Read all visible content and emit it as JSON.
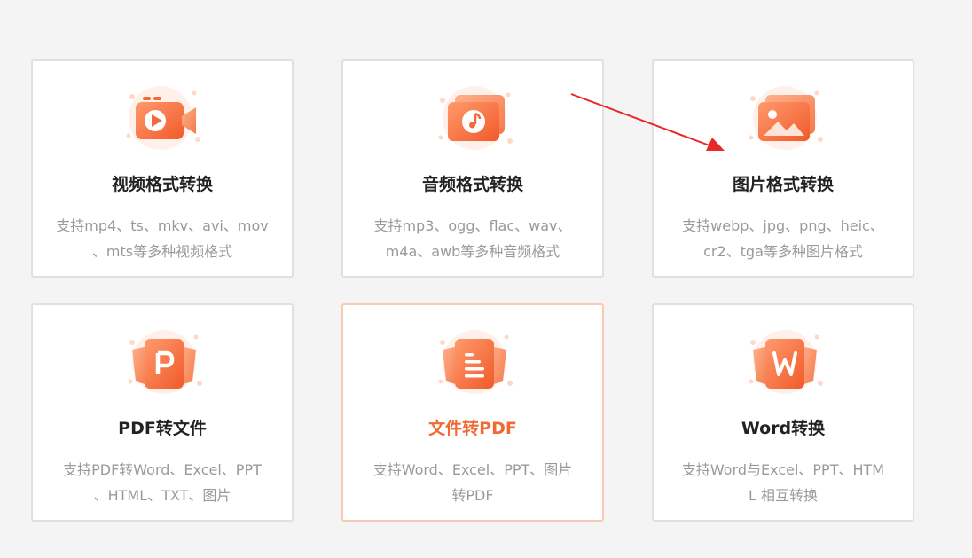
{
  "colors": {
    "accent": "#f06a35",
    "title": "#222222",
    "description": "#9a9a9a",
    "card_border": "#e0e0e0",
    "active_border": "#f8c9b4",
    "background": "#f4f4f4",
    "annotation_arrow": "#e8292a"
  },
  "cards": [
    {
      "icon": "video-camera-icon",
      "title": "视频格式转换",
      "desc_line1": "支持mp4、ts、mkv、avi、mov",
      "desc_line2": "、mts等多种视频格式",
      "active": false
    },
    {
      "icon": "music-note-icon",
      "title": "音频格式转换",
      "desc_line1": "支持mp3、ogg、flac、wav、",
      "desc_line2": "m4a、awb等多种音频格式",
      "active": false
    },
    {
      "icon": "image-landscape-icon",
      "title": "图片格式转换",
      "desc_line1": "支持webp、jpg、png、heic、",
      "desc_line2": "cr2、tga等多种图片格式",
      "active": false
    },
    {
      "icon": "pdf-p-icon",
      "title": "PDF转文件",
      "desc_line1": "支持PDF转Word、Excel、PPT",
      "desc_line2": "、HTML、TXT、图片",
      "active": false
    },
    {
      "icon": "document-lines-icon",
      "title": "文件转PDF",
      "desc_line1": "支持Word、Excel、PPT、图片",
      "desc_line2": "转PDF",
      "active": true
    },
    {
      "icon": "word-w-icon",
      "title": "Word转换",
      "desc_line1": "支持Word与Excel、PPT、HTM",
      "desc_line2": "L 相互转换",
      "active": false
    }
  ]
}
